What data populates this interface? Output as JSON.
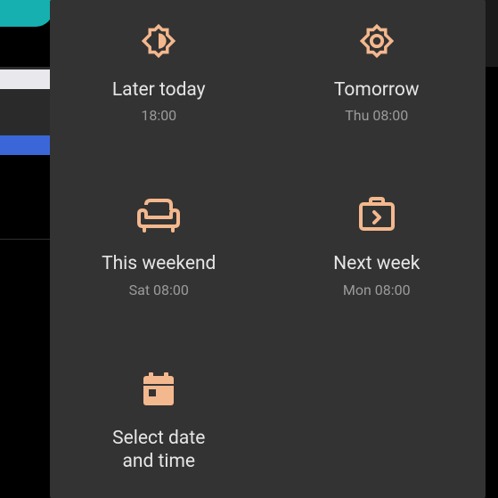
{
  "colors": {
    "accent": "#f4b88e"
  },
  "options": {
    "later_today": {
      "label": "Later today",
      "sub": "18:00",
      "icon": "brightness-medium-icon"
    },
    "tomorrow": {
      "label": "Tomorrow",
      "sub": "Thu 08:00",
      "icon": "brightness-high-icon"
    },
    "weekend": {
      "label": "This weekend",
      "sub": "Sat 08:00",
      "icon": "couch-icon"
    },
    "next_week": {
      "label": "Next week",
      "sub": "Mon 08:00",
      "icon": "briefcase-icon"
    },
    "custom": {
      "label": "Select date\nand time",
      "sub": "",
      "icon": "calendar-icon"
    }
  }
}
